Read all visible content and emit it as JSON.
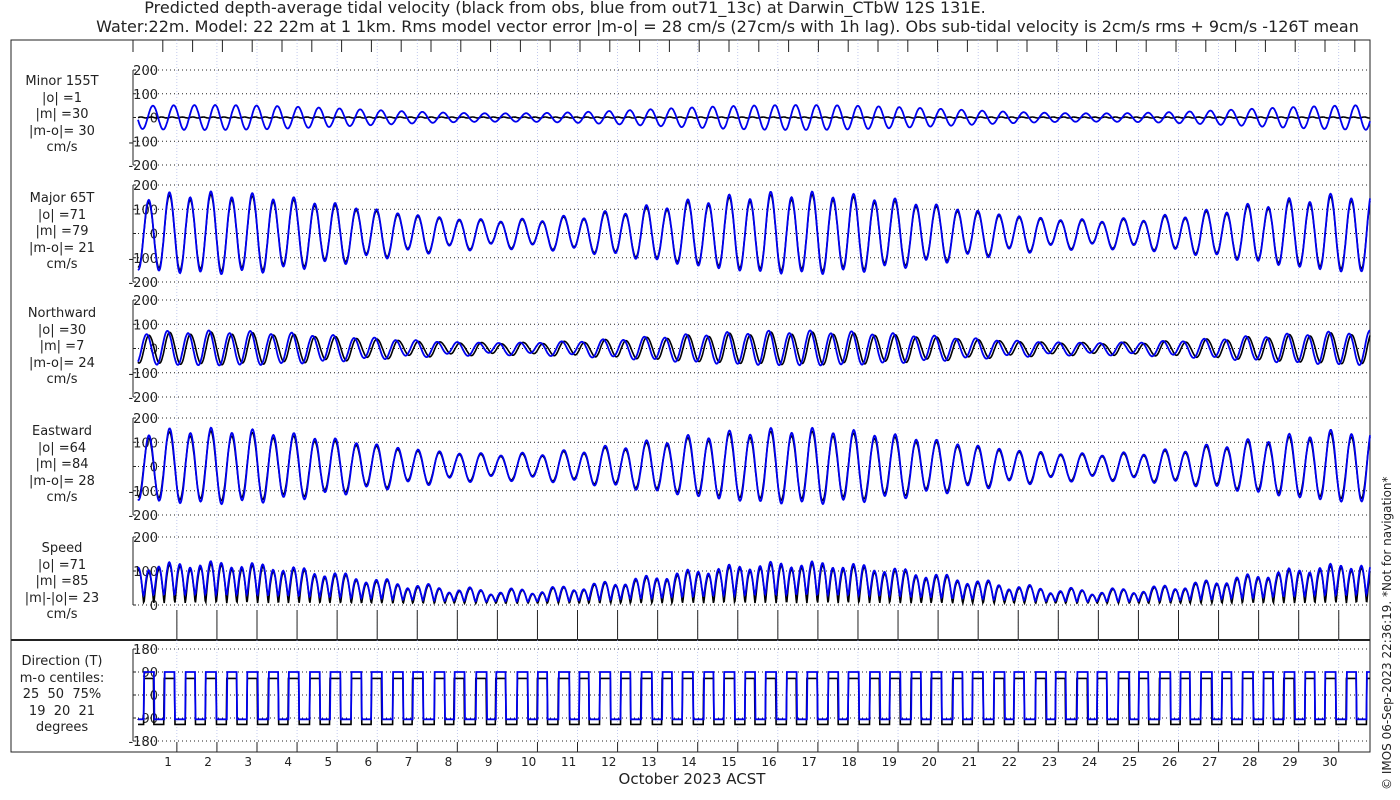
{
  "title_line1": "Predicted depth-average tidal velocity (black from obs, blue from out71_13c) at Darwin_CTbW 12S 131E.",
  "title_line2": "Water:22m. Model: 22 22m at 1 1km. Rms model vector error |m-o| = 28 cm/s (27cm/s with 1h lag). Obs sub-tidal velocity is 2cm/s rms + 9cm/s -126T mean",
  "copyright": "© IMOS 06-Sep-2023 22:36:19. *Not for navigation*",
  "colors": {
    "obs": "#000000",
    "model": "#0000ee",
    "grid_vertical": "#aab4e6"
  },
  "chart_data": {
    "type": "line",
    "title": "Predicted depth-average tidal velocity",
    "xlabel": "October 2023 ACST",
    "x_ticks": [
      "1",
      "2",
      "3",
      "4",
      "5",
      "6",
      "7",
      "8",
      "9",
      "10",
      "11",
      "12",
      "13",
      "14",
      "15",
      "16",
      "17",
      "18",
      "19",
      "20",
      "21",
      "22",
      "23",
      "24",
      "25",
      "26",
      "27",
      "28",
      "29",
      "30"
    ],
    "xlim_days": [
      0.25,
      31.0
    ],
    "legend": [
      "black from obs",
      "blue from out71_13c"
    ],
    "tide_model": {
      "semidiurnal_period_h": 12.42,
      "springs_days": [
        2,
        16.8,
        31
      ],
      "neaps_days": [
        9.4,
        24
      ],
      "major_axis_T": 65,
      "major_amp_spring_obs": 150,
      "major_amp_neap_obs": 50,
      "minor_amp_model_ratio": 0.35
    },
    "panels": [
      {
        "id": "minor",
        "label_lines": [
          "Minor 155T",
          "|o| =1",
          "|m| =30",
          "|m-o|= 30",
          "cm/s"
        ],
        "ylim": [
          -200,
          200
        ],
        "yticks": [
          "200",
          "100",
          "0",
          "-100",
          "-200"
        ]
      },
      {
        "id": "major",
        "label_lines": [
          "Major 65T",
          "|o| =71",
          "|m| =79",
          "|m-o|= 21",
          "cm/s"
        ],
        "ylim": [
          -200,
          200
        ],
        "yticks": [
          "200",
          "100",
          "0",
          "-100",
          "-200"
        ]
      },
      {
        "id": "north",
        "label_lines": [
          "Northward",
          "|o| =30",
          "|m| =7",
          "|m-o|= 24",
          "cm/s"
        ],
        "ylim": [
          -200,
          200
        ],
        "yticks": [
          "200",
          "100",
          "0",
          "-100",
          "-200"
        ]
      },
      {
        "id": "east",
        "label_lines": [
          "Eastward",
          "|o| =64",
          "|m| =84",
          "|m-o|= 28",
          "cm/s"
        ],
        "ylim": [
          -200,
          200
        ],
        "yticks": [
          "200",
          "100",
          "0",
          "-100",
          "-200"
        ]
      },
      {
        "id": "speed",
        "label_lines": [
          "Speed",
          "|o| =71",
          "|m| =85",
          "|m|-|o|= 23",
          "cm/s"
        ],
        "ylim": [
          0,
          200
        ],
        "yticks": [
          "200",
          "100",
          "0"
        ]
      },
      {
        "id": "direction",
        "label_lines": [
          "Direction (T)",
          "m-o centiles:",
          "25  50  75%",
          "19  20  21",
          "degrees"
        ],
        "ylim": [
          -180,
          180
        ],
        "yticks": [
          "180",
          "90",
          "0",
          "-90",
          "-180"
        ]
      }
    ]
  }
}
